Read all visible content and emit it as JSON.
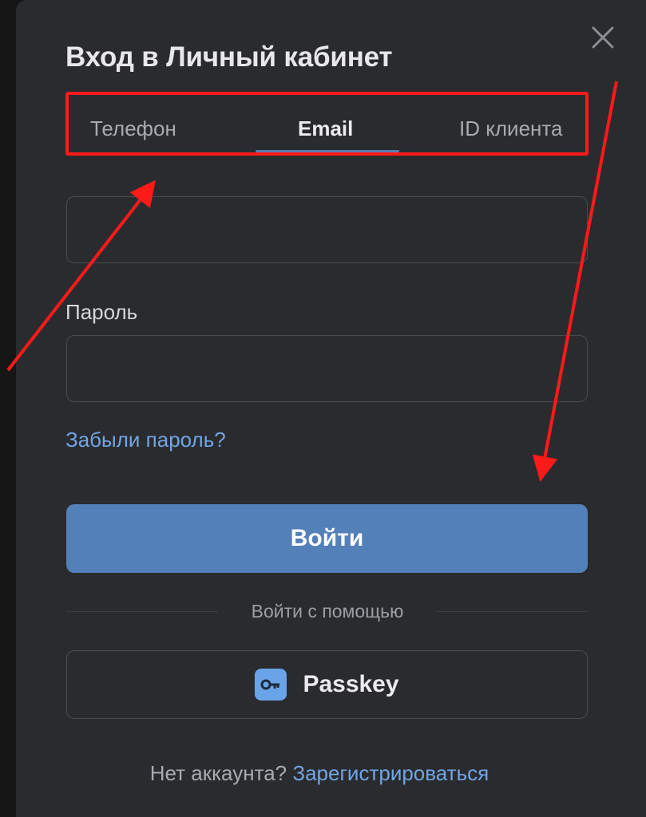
{
  "modal": {
    "title": "Вход в Личный кабинет",
    "tabs": [
      {
        "label": "Телефон",
        "active": false
      },
      {
        "label": "Email",
        "active": true
      },
      {
        "label": "ID клиента",
        "active": false
      }
    ],
    "email_field": {
      "value": "",
      "placeholder": ""
    },
    "password_label": "Пароль",
    "password_field": {
      "value": "",
      "placeholder": ""
    },
    "forgot_password": "Забыли пароль?",
    "login_button": "Войти",
    "divider_text": "Войти с помощью",
    "passkey_button": "Passkey",
    "no_account_text": "Нет аккаунта?",
    "register_link": "Зарегистрироваться"
  },
  "icons": {
    "close": "close-icon",
    "passkey": "key-icon"
  },
  "colors": {
    "background": "#2a2b2e",
    "accent": "#5380b8",
    "link": "#71a5e6",
    "annotation": "#ff1a1a"
  }
}
